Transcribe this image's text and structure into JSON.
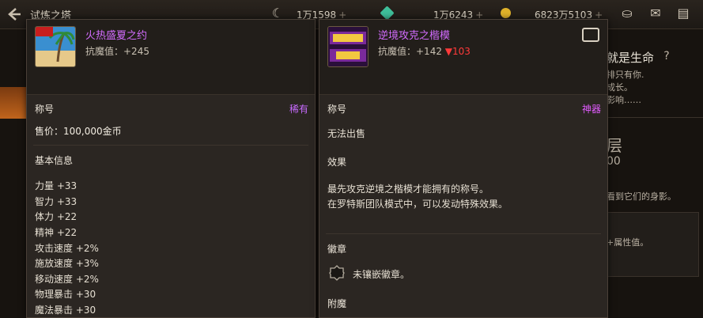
{
  "topbar": {
    "title": "试炼之塔",
    "currency1": "1万1598",
    "currency2": "1万6243",
    "currency3": "6823万5103",
    "plus_glyph": "+",
    "icons": [
      "back-arrow-icon",
      "moon-icon",
      "gem-icon",
      "gold-coin-icon",
      "pot-icon",
      "mail-icon",
      "chat-icon"
    ]
  },
  "background": {
    "right_title": "就是生命",
    "right_line1": "排只有你.",
    "right_line2": "成长。",
    "right_line3": "影响……",
    "floor_char": "层",
    "floor_num": "00",
    "shadow_text": "看到它们的身影。",
    "attr_text": "+属性值。"
  },
  "item1": {
    "name": "火热盛夏之约",
    "resist": "抗魔值：+245",
    "type_label": "称号",
    "rarity": "稀有",
    "rarity_color": "#c86bff",
    "price": "售价：100,000金币",
    "basic_title": "基本信息",
    "stats": [
      "力量 +33",
      "智力 +33",
      "体力 +22",
      "精神 +22",
      "攻击速度 +2%",
      "施放速度 +3%",
      "移动速度 +2%",
      "物理暴击 +30",
      "魔法暴击 +30"
    ]
  },
  "item2": {
    "name": "逆境攻克之楷模",
    "resist": "抗魔值：+142",
    "resist_down": "▼103",
    "type_label": "称号",
    "rarity": "神器",
    "rarity_color": "#e25cff",
    "nosell": "无法出售",
    "effect_title": "效果",
    "effect_line1": "最先攻克逆境之楷模才能拥有的称号。",
    "effect_line2": "在罗特斯团队模式中，可以发动特殊效果。",
    "badge_title": "徽章",
    "badge_text": "未镶嵌徽章。",
    "enchant_title": "附魔"
  }
}
